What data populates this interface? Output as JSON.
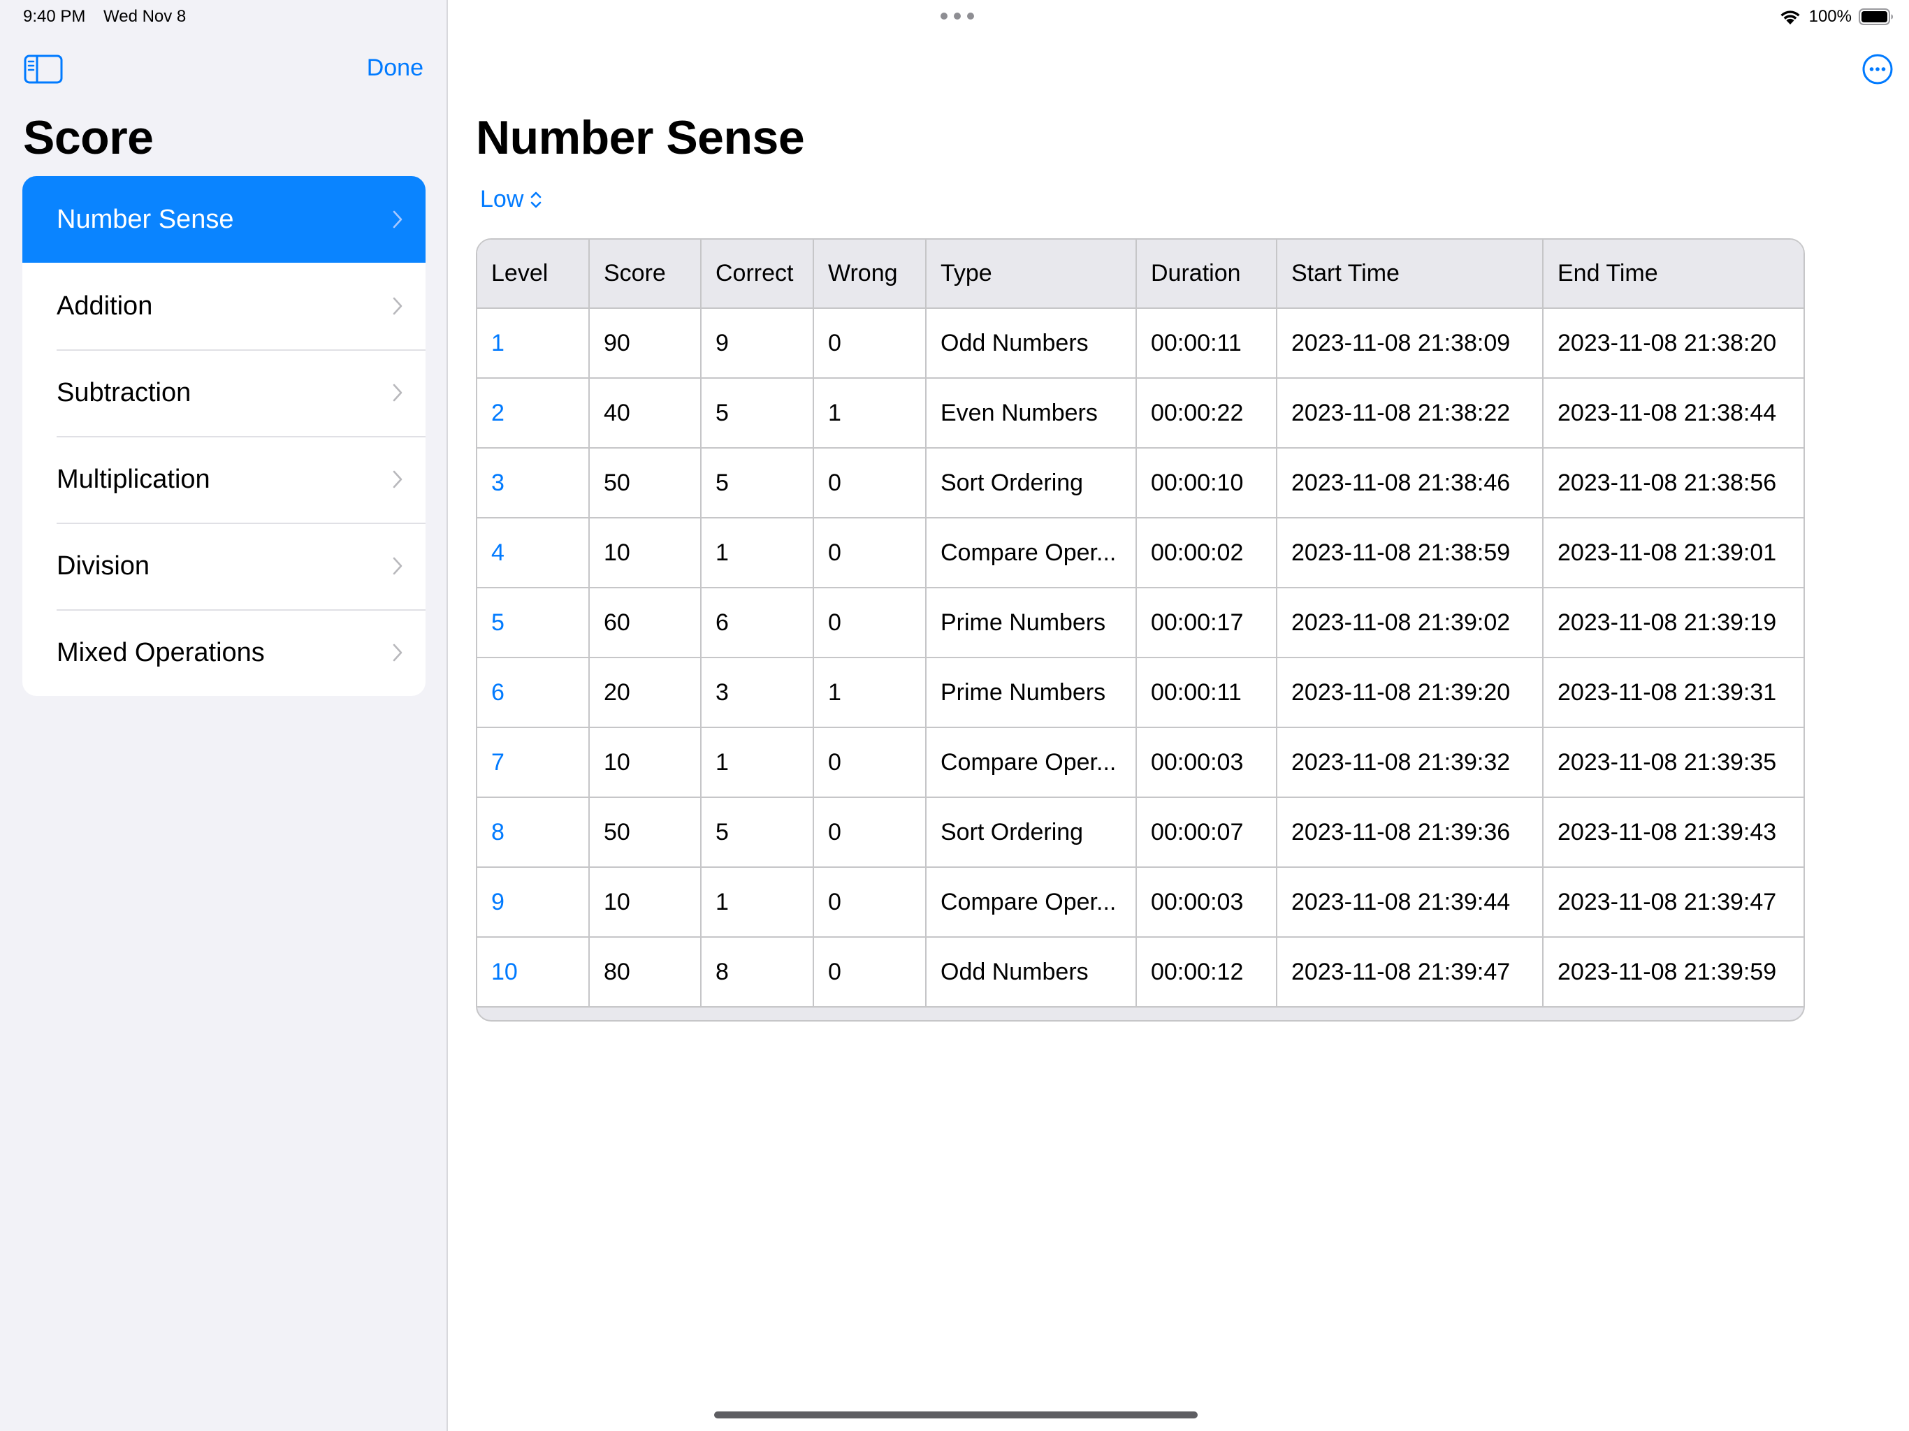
{
  "status_bar": {
    "time": "9:40 PM",
    "date": "Wed Nov 8",
    "battery": "100%"
  },
  "sidebar": {
    "title": "Score",
    "done_label": "Done",
    "items": [
      {
        "label": "Number Sense"
      },
      {
        "label": "Addition"
      },
      {
        "label": "Subtraction"
      },
      {
        "label": "Multiplication"
      },
      {
        "label": "Division"
      },
      {
        "label": "Mixed Operations"
      }
    ],
    "selected_item": "Number Sense"
  },
  "main": {
    "title": "Number Sense",
    "difficulty": "Low",
    "table": {
      "headers": [
        "Level",
        "Score",
        "Correct",
        "Wrong",
        "Type",
        "Duration",
        "Start Time",
        "End Time"
      ],
      "rows": [
        [
          "1",
          "90",
          "9",
          "0",
          "Odd Numbers",
          "00:00:11",
          "2023-11-08 21:38:09",
          "2023-11-08 21:38:20"
        ],
        [
          "2",
          "40",
          "5",
          "1",
          "Even Numbers",
          "00:00:22",
          "2023-11-08 21:38:22",
          "2023-11-08 21:38:44"
        ],
        [
          "3",
          "50",
          "5",
          "0",
          "Sort Ordering",
          "00:00:10",
          "2023-11-08 21:38:46",
          "2023-11-08 21:38:56"
        ],
        [
          "4",
          "10",
          "1",
          "0",
          "Compare Oper...",
          "00:00:02",
          "2023-11-08 21:38:59",
          "2023-11-08 21:39:01"
        ],
        [
          "5",
          "60",
          "6",
          "0",
          "Prime Numbers",
          "00:00:17",
          "2023-11-08 21:39:02",
          "2023-11-08 21:39:19"
        ],
        [
          "6",
          "20",
          "3",
          "1",
          "Prime Numbers",
          "00:00:11",
          "2023-11-08 21:39:20",
          "2023-11-08 21:39:31"
        ],
        [
          "7",
          "10",
          "1",
          "0",
          "Compare Oper...",
          "00:00:03",
          "2023-11-08 21:39:32",
          "2023-11-08 21:39:35"
        ],
        [
          "8",
          "50",
          "5",
          "0",
          "Sort Ordering",
          "00:00:07",
          "2023-11-08 21:39:36",
          "2023-11-08 21:39:43"
        ],
        [
          "9",
          "10",
          "1",
          "0",
          "Compare Oper...",
          "00:00:03",
          "2023-11-08 21:39:44",
          "2023-11-08 21:39:47"
        ],
        [
          "10",
          "80",
          "8",
          "0",
          "Odd Numbers",
          "00:00:12",
          "2023-11-08 21:39:47",
          "2023-11-08 21:39:59"
        ]
      ]
    }
  },
  "colors": {
    "accent": "#007aff",
    "selected_row": "#0a84ff",
    "sidebar_bg": "#f2f2f7",
    "header_bg": "#e8e8ed",
    "grid_line": "#c6c6c8"
  },
  "icons": {
    "sidebar_toggle": "sidebar-toggle-icon",
    "more": "ellipsis-circle-icon",
    "chevron": "chevron-right-icon",
    "picker": "chevron-up-down-icon",
    "wifi": "wifi-icon",
    "battery": "battery-full-icon"
  }
}
